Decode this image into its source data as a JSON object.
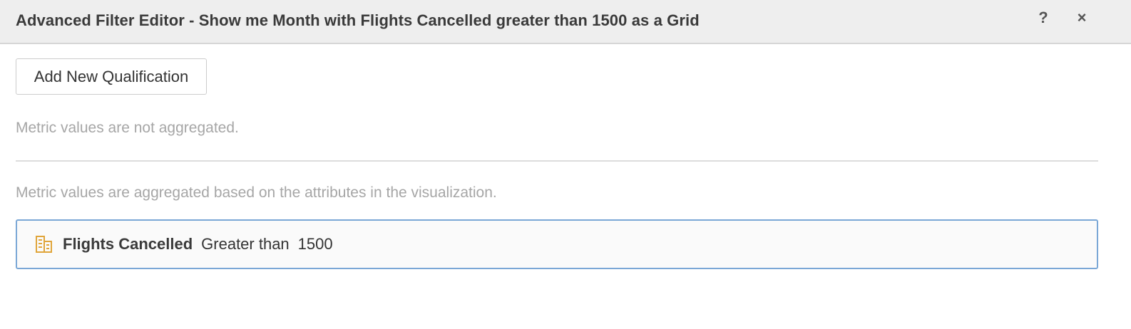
{
  "dialog": {
    "title": "Advanced Filter Editor - Show me Month with Flights Cancelled greater than 1500 as a Grid",
    "help_label": "?",
    "close_label": "×"
  },
  "toolbar": {
    "add_label": "Add New Qualification"
  },
  "sections": {
    "not_aggregated_note": "Metric values are not aggregated.",
    "aggregated_note": "Metric values are aggregated based on the attributes in the visualization."
  },
  "qualification": {
    "icon": "metric-icon",
    "metric": "Flights Cancelled",
    "operator": "Greater than",
    "value": "1500"
  },
  "colors": {
    "icon": "#e0a53a",
    "selection_border": "#7aa7d6"
  }
}
